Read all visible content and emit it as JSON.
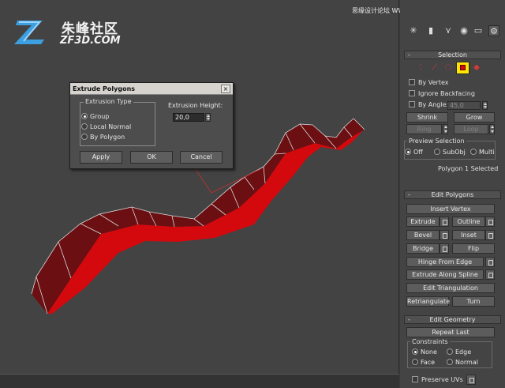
{
  "watermark": {
    "brand_cn": "朱峰社区",
    "brand_en": "ZF3D.COM",
    "top_right": "思缘设计论坛 WWW.MISSYUAN.COM"
  },
  "dialog": {
    "title": "Extrude Polygons",
    "close_glyph": "×",
    "extrusion_type": {
      "label": "Extrusion Type",
      "options": [
        "Group",
        "Local Normal",
        "By Polygon"
      ],
      "selected": "Group"
    },
    "extrusion_height": {
      "label": "Extrusion Height:",
      "value": "20,0"
    },
    "buttons": {
      "apply": "Apply",
      "ok": "OK",
      "cancel": "Cancel"
    }
  },
  "command_panel": {
    "tab_icons": [
      "create-icon",
      "modify-icon",
      "hierarchy-icon",
      "motion-icon",
      "display-icon",
      "utilities-icon"
    ],
    "selection": {
      "title": "Selection",
      "level_icons": [
        "vertex-icon",
        "edge-icon",
        "border-icon",
        "polygon-icon",
        "element-icon"
      ],
      "active_level": "polygon-icon",
      "by_vertex": "By Vertex",
      "ignore_backfacing": "Ignore Backfacing",
      "by_angle": "By Angle:",
      "angle_value": "45,0",
      "shrink": "Shrink",
      "grow": "Grow",
      "ring": "Ring",
      "loop": "Loop",
      "preview_selection": {
        "label": "Preview Selection",
        "options": [
          "Off",
          "SubObj",
          "Multi"
        ],
        "selected": "Off"
      },
      "status": "Polygon 1 Selected"
    },
    "edit_polygons": {
      "title": "Edit Polygons",
      "insert_vertex": "Insert Vertex",
      "extrude": "Extrude",
      "outline": "Outline",
      "bevel": "Bevel",
      "inset": "Inset",
      "bridge": "Bridge",
      "flip": "Flip",
      "hinge_from_edge": "Hinge From Edge",
      "extrude_along_spline": "Extrude Along Spline",
      "edit_triangulation": "Edit Triangulation",
      "retriangulate": "Retriangulate",
      "turn": "Turn"
    },
    "edit_geometry": {
      "title": "Edit Geometry",
      "repeat_last": "Repeat Last",
      "constraints": {
        "label": "Constraints",
        "options": [
          "None",
          "Edge",
          "Face",
          "Normal"
        ],
        "selected": "None"
      },
      "preserve_uvs": "Preserve UVs"
    },
    "rollout_collapse_glyph": "-"
  },
  "colors": {
    "mesh_top": "#6b0f12",
    "mesh_side": "#d4090e",
    "highlight": "#ffe600",
    "viewport_bg": "#434343"
  }
}
